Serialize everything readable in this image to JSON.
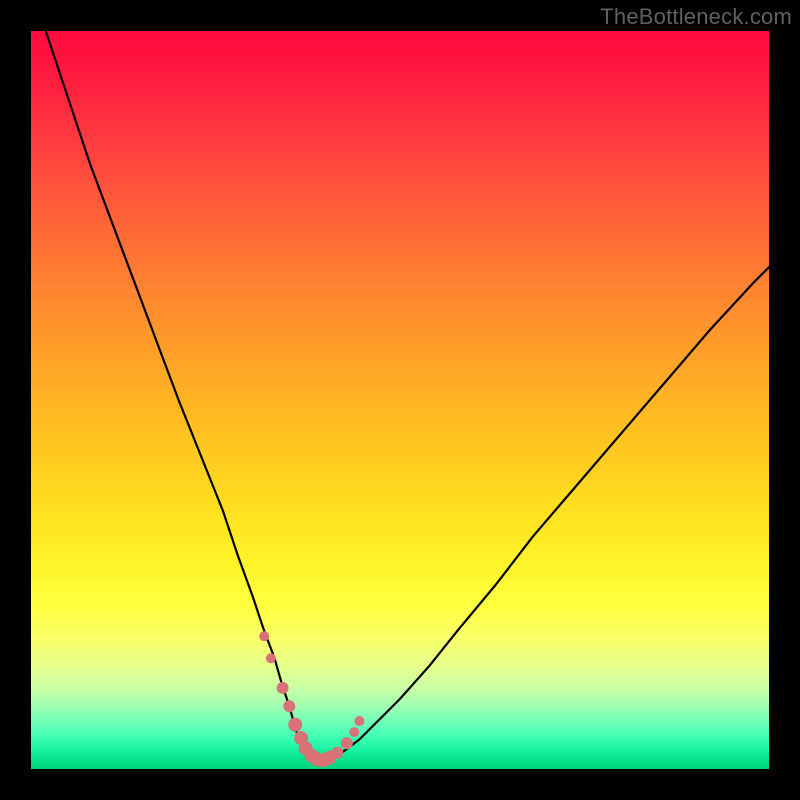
{
  "watermark": "TheBottleneck.com",
  "colors": {
    "curve_stroke": "#000000",
    "dot_fill": "#d97277",
    "frame_bg": "#000000"
  },
  "chart_data": {
    "type": "line",
    "title": "",
    "xlabel": "",
    "ylabel": "",
    "xlim": [
      0,
      100
    ],
    "ylim": [
      0,
      100
    ],
    "grid": false,
    "legend": false,
    "series": [
      {
        "name": "bottleneck-curve",
        "x": [
          2,
          5,
          8,
          11,
          14,
          17,
          20,
          23,
          26,
          28,
          30,
          31.5,
          33,
          34,
          35,
          35.7,
          36.3,
          37,
          37.8,
          38.7,
          39.8,
          41,
          42.5,
          44.5,
          47,
          50,
          54,
          58,
          63,
          68,
          74,
          80,
          86,
          92,
          98,
          100
        ],
        "y": [
          100,
          91,
          82,
          74,
          66,
          58,
          50,
          42.5,
          35,
          29,
          23.5,
          19,
          15,
          11.5,
          8.5,
          6,
          4,
          2.5,
          1.5,
          1,
          1,
          1.5,
          2.5,
          4,
          6.5,
          9.5,
          14,
          19,
          25,
          31.5,
          38.5,
          45.5,
          52.5,
          59.5,
          66,
          68
        ]
      }
    ],
    "markers": {
      "name": "highlight-dots",
      "x": [
        31.6,
        32.5,
        34.1,
        35.0,
        35.8,
        36.6,
        37.2,
        38.0,
        38.8,
        39.6,
        40.4,
        41.5,
        42.8,
        43.8,
        44.5
      ],
      "y": [
        18.0,
        15.0,
        11.0,
        8.5,
        6.0,
        4.2,
        2.8,
        1.8,
        1.3,
        1.2,
        1.5,
        2.2,
        3.5,
        5.0,
        6.5
      ],
      "r": [
        5,
        5,
        6,
        6,
        7,
        7,
        7,
        7,
        7,
        7,
        7,
        6,
        6,
        5,
        5
      ]
    }
  }
}
